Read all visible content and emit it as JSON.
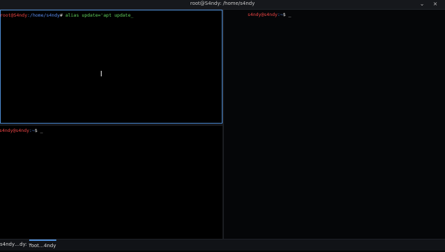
{
  "window": {
    "title": "root@S4ndy: /home/s4ndy",
    "minimize_symbol": "⌄",
    "close_symbol": "×"
  },
  "panes": {
    "top_left": {
      "prompt": "root@S4ndy",
      "path": ":/home/s4ndy",
      "symbol": "#",
      "command": " alias update='apt update_"
    },
    "bottom_left": {
      "user": "s4ndy@s4ndy",
      "path": ":~",
      "symbol": "$",
      "cursor": " _"
    },
    "right": {
      "user": "s4ndy@s4ndy",
      "path": ":~",
      "symbol": "$",
      "cursor": " _"
    }
  },
  "taskbar": {
    "items": [
      {
        "label": "s4ndy…dy: ~"
      },
      {
        "label": "root…4ndy"
      }
    ]
  },
  "colors": {
    "active_border": "#4f8fd8",
    "prompt_red": "#ee4545",
    "path_blue": "#5a8df0",
    "command_green": "#63d75f"
  },
  "icons": {
    "mouse_cursor": "text-cursor-icon"
  }
}
